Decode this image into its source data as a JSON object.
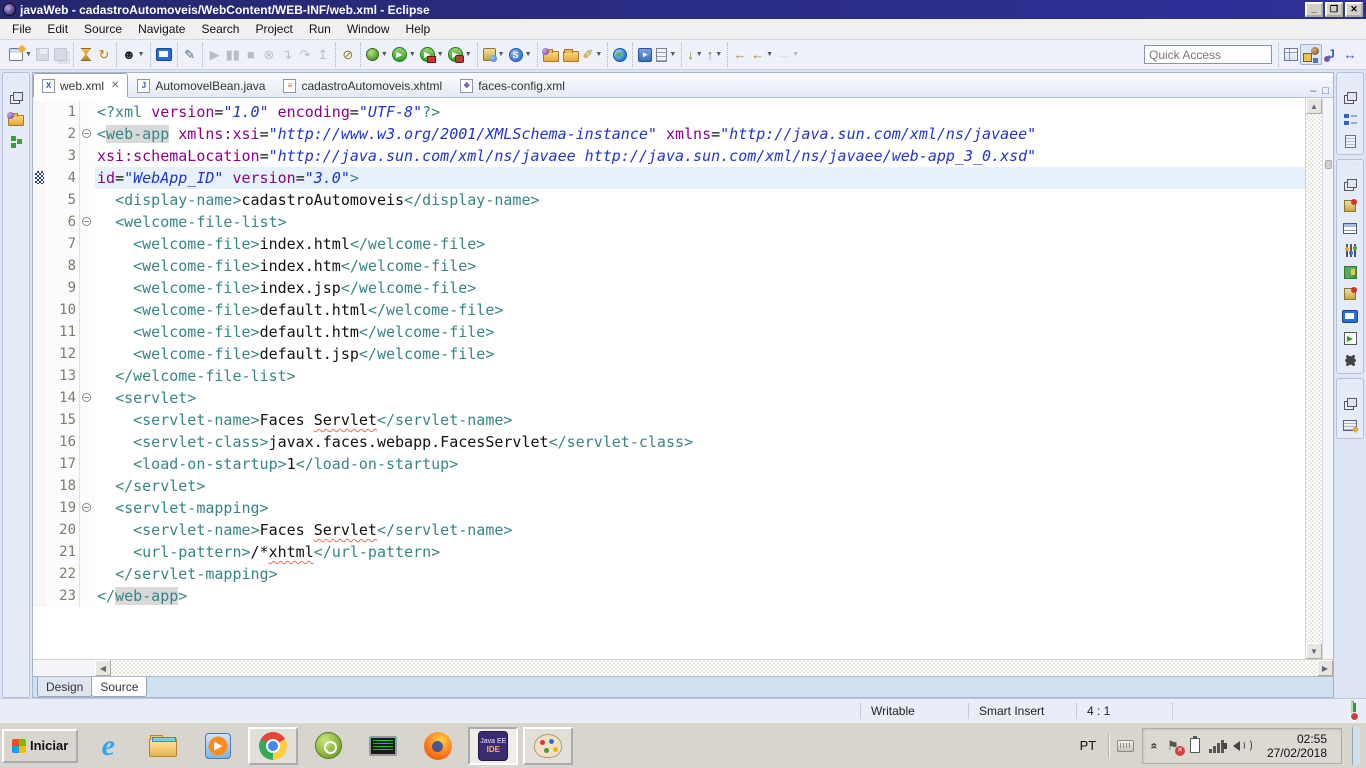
{
  "window": {
    "title": "javaWeb - cadastroAutomoveis/WebContent/WEB-INF/web.xml - Eclipse",
    "controls": {
      "minimize": "_",
      "restore": "❐",
      "close": "✕"
    }
  },
  "menu": {
    "items": [
      "File",
      "Edit",
      "Source",
      "Navigate",
      "Search",
      "Project",
      "Run",
      "Window",
      "Help"
    ]
  },
  "toolbar": {
    "quick_access_placeholder": "Quick Access",
    "groups": [
      {
        "items": [
          {
            "n": "new-icon",
            "cls": "win",
            "dd": true
          },
          {
            "n": "save-icon",
            "cls": "disk",
            "dis": true
          },
          {
            "n": "save-all-icon",
            "cls": "disk2",
            "dis": true
          }
        ]
      },
      {
        "items": [
          {
            "n": "build-all-icon",
            "cls": "spool"
          },
          {
            "n": "refresh-icon",
            "g": "↻",
            "c": "#b8860b"
          }
        ]
      },
      {
        "items": [
          {
            "n": "user-account-icon",
            "g": "☻",
            "c": "#222",
            "dd": true
          }
        ]
      },
      {
        "items": [
          {
            "n": "open-console-icon",
            "cls": "monitor"
          }
        ]
      },
      {
        "items": [
          {
            "n": "mark-occurrences-icon",
            "g": "✎",
            "c": "#4a6a9a"
          }
        ]
      },
      {
        "items": [
          {
            "n": "resume-icon",
            "g": "▶",
            "c": "#667",
            "dis": true
          },
          {
            "n": "suspend-icon",
            "g": "▮▮",
            "c": "#667",
            "dis": true
          },
          {
            "n": "terminate-icon",
            "g": "■",
            "c": "#667",
            "dis": true
          },
          {
            "n": "disconnect-icon",
            "g": "⊗",
            "c": "#667",
            "dis": true
          },
          {
            "n": "step-into-icon",
            "g": "↴",
            "c": "#667",
            "dis": true
          },
          {
            "n": "step-over-icon",
            "g": "↷",
            "c": "#667",
            "dis": true
          },
          {
            "n": "step-return-icon",
            "g": "↥",
            "c": "#667",
            "dis": true
          }
        ]
      },
      {
        "items": [
          {
            "n": "skip-breakpoints-icon",
            "g": "⊘",
            "c": "#8a7a2a"
          }
        ]
      },
      {
        "items": [
          {
            "n": "debug-icon",
            "cls": "bug",
            "dd": true
          },
          {
            "n": "run-icon",
            "cls": "runc",
            "g": "▶",
            "dd": true
          },
          {
            "n": "run-on-server-icon",
            "cls": "runc runs",
            "g": "▶",
            "dd": true
          },
          {
            "n": "profile-icon",
            "cls": "runc prof",
            "g": "▶",
            "dd": true
          }
        ]
      },
      {
        "items": [
          {
            "n": "new-javaee-wizard-icon",
            "cls": "jar",
            "dd": true
          },
          {
            "n": "web-service-wizard-icon",
            "cls": "ws",
            "g": "S",
            "dd": true
          }
        ]
      },
      {
        "items": [
          {
            "n": "import-icon",
            "cls": "folder fball"
          },
          {
            "n": "export-icon",
            "cls": "folder"
          },
          {
            "n": "highlighter-icon",
            "g": "✐",
            "c": "#b8860b",
            "dd": true
          }
        ]
      },
      {
        "items": [
          {
            "n": "open-browser-icon",
            "cls": "globe"
          }
        ]
      },
      {
        "items": [
          {
            "n": "external-tools-icon",
            "cls": "ext",
            "g": "►"
          },
          {
            "n": "cheat-sheets-icon",
            "cls": "cab",
            "dd": true
          }
        ]
      },
      {
        "items": [
          {
            "n": "next-annotation-icon",
            "g": "↓",
            "c": "#8a7a2a",
            "dd": true
          },
          {
            "n": "previous-annotation-icon",
            "g": "↑",
            "c": "#8a7a2a",
            "dd": true
          }
        ]
      },
      {
        "items": [
          {
            "n": "last-edit-location-icon",
            "g": "←",
            "c": "#b8860b"
          },
          {
            "n": "back-icon",
            "g": "←",
            "c": "#b8860b",
            "dd": true
          },
          {
            "n": "forward-icon",
            "g": "→",
            "c": "#99a",
            "dis": true,
            "dd": true
          }
        ]
      }
    ],
    "perspectives": [
      {
        "n": "open-perspective-icon",
        "cls": "persp"
      },
      {
        "n": "javaee-perspective-button",
        "cls": "pjee",
        "active": true
      },
      {
        "n": "java-perspective-button",
        "cls": "pjava",
        "g": "J"
      },
      {
        "n": "other-perspective-button",
        "g": "↔",
        "c": "#3a5ac0"
      }
    ]
  },
  "left_stack": {
    "icons": [
      {
        "n": "restore-pane-icon",
        "cls": "rest"
      },
      {
        "n": "project-explorer-icon",
        "cls": "folder fball"
      },
      {
        "n": "outline-tree-icon",
        "cls": "tree"
      }
    ]
  },
  "right_stacks": [
    {
      "icons": [
        {
          "n": "restore-pane-icon",
          "cls": "rest"
        },
        {
          "n": "outline-icon",
          "cls": "out"
        },
        {
          "n": "templates-icon",
          "cls": "templ"
        }
      ]
    },
    {
      "icons": [
        {
          "n": "restore-pane-icon",
          "cls": "rest"
        },
        {
          "n": "servers-icon",
          "cls": "serv"
        },
        {
          "n": "data-source-explorer-icon",
          "cls": "dse"
        },
        {
          "n": "snippets-icon",
          "cls": "snip"
        },
        {
          "n": "palette-icon",
          "cls": "pal"
        },
        {
          "n": "bookmarks-icon",
          "cls": "serv"
        },
        {
          "n": "console-icon",
          "cls": "monitor"
        },
        {
          "n": "shortcuts-icon",
          "cls": "short",
          "g": "▶"
        },
        {
          "n": "spider-icon",
          "cls": "spider"
        }
      ]
    },
    {
      "icons": [
        {
          "n": "restore-pane-icon",
          "cls": "rest"
        },
        {
          "n": "properties-icon",
          "cls": "props"
        }
      ]
    }
  ],
  "editor_tabs": [
    {
      "label": "web.xml",
      "icon": {
        "name": "xml-file-icon",
        "glyph": "X",
        "color": "#2a5ac0"
      },
      "active": true,
      "close": "✕"
    },
    {
      "label": "AutomovelBean.java",
      "icon": {
        "name": "java-file-icon",
        "glyph": "J",
        "color": "#2a5ac0"
      }
    },
    {
      "label": "cadastroAutomoveis.xhtml",
      "icon": {
        "name": "xhtml-file-icon",
        "glyph": "≡",
        "color": "#c06a2a"
      }
    },
    {
      "label": "faces-config.xml",
      "icon": {
        "name": "faces-config-icon",
        "glyph": "❖",
        "color": "#7a5ab0"
      }
    }
  ],
  "tabbar_controls": {
    "minimize": "–",
    "maximize": "□"
  },
  "editor": {
    "colors": {
      "tag": "#368585",
      "attribute": "#8b008b",
      "value": "#2233cc",
      "text": "#111111",
      "current_line_bg": "#e7f1fc",
      "occurrence_bg": "#d9d9d9"
    },
    "lines": [
      {
        "n": 1,
        "segs": [
          [
            "t",
            "<?xml "
          ],
          [
            "a",
            "version"
          ],
          [
            "x",
            "="
          ],
          [
            "v",
            "\"1.0\""
          ],
          [
            "x",
            " "
          ],
          [
            "a",
            "encoding"
          ],
          [
            "x",
            "="
          ],
          [
            "v",
            "\"UTF-8\""
          ],
          [
            "t",
            "?>"
          ]
        ]
      },
      {
        "n": 2,
        "fold": true,
        "segs": [
          [
            "t",
            "<"
          ],
          [
            "hl",
            "web-app"
          ],
          [
            "x",
            " "
          ],
          [
            "a",
            "xmlns:xsi"
          ],
          [
            "x",
            "="
          ],
          [
            "v",
            "\"http://www.w3.org/2001/XMLSchema-instance\""
          ],
          [
            "x",
            " "
          ],
          [
            "a",
            "xmlns"
          ],
          [
            "x",
            "="
          ],
          [
            "v",
            "\"http://java.sun.com/xml/ns/javaee\""
          ]
        ]
      },
      {
        "n": 3,
        "segs": [
          [
            "a",
            "xsi:schemaLocation"
          ],
          [
            "x",
            "="
          ],
          [
            "v",
            "\"http://java.sun.com/xml/ns/javaee http://java.sun.com/xml/ns/javaee/web-app_3_0.xsd\""
          ]
        ]
      },
      {
        "n": 4,
        "cur": true,
        "range": true,
        "segs": [
          [
            "a",
            "id"
          ],
          [
            "x",
            "="
          ],
          [
            "v",
            "\"WebApp_ID\""
          ],
          [
            "x",
            " "
          ],
          [
            "a",
            "version"
          ],
          [
            "x",
            "="
          ],
          [
            "v",
            "\"3.0\""
          ],
          [
            "t",
            ">"
          ]
        ]
      },
      {
        "n": 5,
        "segs": [
          [
            "x",
            "  "
          ],
          [
            "t",
            "<display-name>"
          ],
          [
            "x",
            "cadastroAutomoveis"
          ],
          [
            "t",
            "</display-name>"
          ]
        ]
      },
      {
        "n": 6,
        "fold": true,
        "segs": [
          [
            "x",
            "  "
          ],
          [
            "t",
            "<welcome-file-list>"
          ]
        ]
      },
      {
        "n": 7,
        "segs": [
          [
            "x",
            "    "
          ],
          [
            "t",
            "<welcome-file>"
          ],
          [
            "x",
            "index.html"
          ],
          [
            "t",
            "</welcome-file>"
          ]
        ]
      },
      {
        "n": 8,
        "segs": [
          [
            "x",
            "    "
          ],
          [
            "t",
            "<welcome-file>"
          ],
          [
            "x",
            "index.htm"
          ],
          [
            "t",
            "</welcome-file>"
          ]
        ]
      },
      {
        "n": 9,
        "segs": [
          [
            "x",
            "    "
          ],
          [
            "t",
            "<welcome-file>"
          ],
          [
            "x",
            "index.jsp"
          ],
          [
            "t",
            "</welcome-file>"
          ]
        ]
      },
      {
        "n": 10,
        "segs": [
          [
            "x",
            "    "
          ],
          [
            "t",
            "<welcome-file>"
          ],
          [
            "x",
            "default.html"
          ],
          [
            "t",
            "</welcome-file>"
          ]
        ]
      },
      {
        "n": 11,
        "segs": [
          [
            "x",
            "    "
          ],
          [
            "t",
            "<welcome-file>"
          ],
          [
            "x",
            "default.htm"
          ],
          [
            "t",
            "</welcome-file>"
          ]
        ]
      },
      {
        "n": 12,
        "segs": [
          [
            "x",
            "    "
          ],
          [
            "t",
            "<welcome-file>"
          ],
          [
            "x",
            "default.jsp"
          ],
          [
            "t",
            "</welcome-file>"
          ]
        ]
      },
      {
        "n": 13,
        "segs": [
          [
            "x",
            "  "
          ],
          [
            "t",
            "</welcome-file-list>"
          ]
        ]
      },
      {
        "n": 14,
        "fold": true,
        "segs": [
          [
            "x",
            "  "
          ],
          [
            "t",
            "<servlet>"
          ]
        ]
      },
      {
        "n": 15,
        "segs": [
          [
            "x",
            "    "
          ],
          [
            "t",
            "<servlet-name>"
          ],
          [
            "x",
            "Faces "
          ],
          [
            "sp",
            "Servlet"
          ],
          [
            "t",
            "</servlet-name>"
          ]
        ]
      },
      {
        "n": 16,
        "segs": [
          [
            "x",
            "    "
          ],
          [
            "t",
            "<servlet-class>"
          ],
          [
            "x",
            "javax.faces.webapp.FacesServlet"
          ],
          [
            "t",
            "</servlet-class>"
          ]
        ]
      },
      {
        "n": 17,
        "segs": [
          [
            "x",
            "    "
          ],
          [
            "t",
            "<load-on-startup>"
          ],
          [
            "x",
            "1"
          ],
          [
            "t",
            "</load-on-startup>"
          ]
        ]
      },
      {
        "n": 18,
        "segs": [
          [
            "x",
            "  "
          ],
          [
            "t",
            "</servlet>"
          ]
        ]
      },
      {
        "n": 19,
        "fold": true,
        "segs": [
          [
            "x",
            "  "
          ],
          [
            "t",
            "<servlet-mapping>"
          ]
        ]
      },
      {
        "n": 20,
        "segs": [
          [
            "x",
            "    "
          ],
          [
            "t",
            "<servlet-name>"
          ],
          [
            "x",
            "Faces "
          ],
          [
            "sp",
            "Servlet"
          ],
          [
            "t",
            "</servlet-name>"
          ]
        ]
      },
      {
        "n": 21,
        "segs": [
          [
            "x",
            "    "
          ],
          [
            "t",
            "<url-pattern>"
          ],
          [
            "x",
            "/*"
          ],
          [
            "sp",
            "xhtml"
          ],
          [
            "t",
            "</url-pattern>"
          ]
        ]
      },
      {
        "n": 22,
        "segs": [
          [
            "x",
            "  "
          ],
          [
            "t",
            "</servlet-mapping>"
          ]
        ]
      },
      {
        "n": 23,
        "segs": [
          [
            "t",
            "</"
          ],
          [
            "hl",
            "web-app"
          ],
          [
            "t",
            ">"
          ]
        ]
      }
    ]
  },
  "bottom_tabs": [
    {
      "label": "Design"
    },
    {
      "label": "Source",
      "active": true
    }
  ],
  "status_bar": {
    "writable": "Writable",
    "insert_mode": "Smart Insert",
    "cursor_position": "4 : 1"
  },
  "taskbar": {
    "start_label": "Iniciar",
    "apps": [
      {
        "n": "ie-icon",
        "cls": "app-ie",
        "g": "e"
      },
      {
        "n": "windows-explorer-icon",
        "cls": "app-explorer"
      },
      {
        "n": "media-player-icon",
        "cls": "app-wmp"
      },
      {
        "n": "chrome-icon",
        "cls": "app-chrome",
        "state": "open"
      },
      {
        "n": "android-studio-icon",
        "cls": "app-android"
      },
      {
        "n": "terminal-icon",
        "cls": "app-terminal"
      },
      {
        "n": "firefox-icon",
        "cls": "app-firefox"
      },
      {
        "n": "eclipse-icon",
        "cls": "app-eclipse",
        "state": "focus",
        "text_lines": [
          "Java EE",
          "IDE"
        ]
      },
      {
        "n": "paint-icon",
        "cls": "app-paint",
        "state": "open"
      }
    ]
  },
  "tray": {
    "language": "PT",
    "time": "02:55",
    "date": "27/02/2018"
  }
}
